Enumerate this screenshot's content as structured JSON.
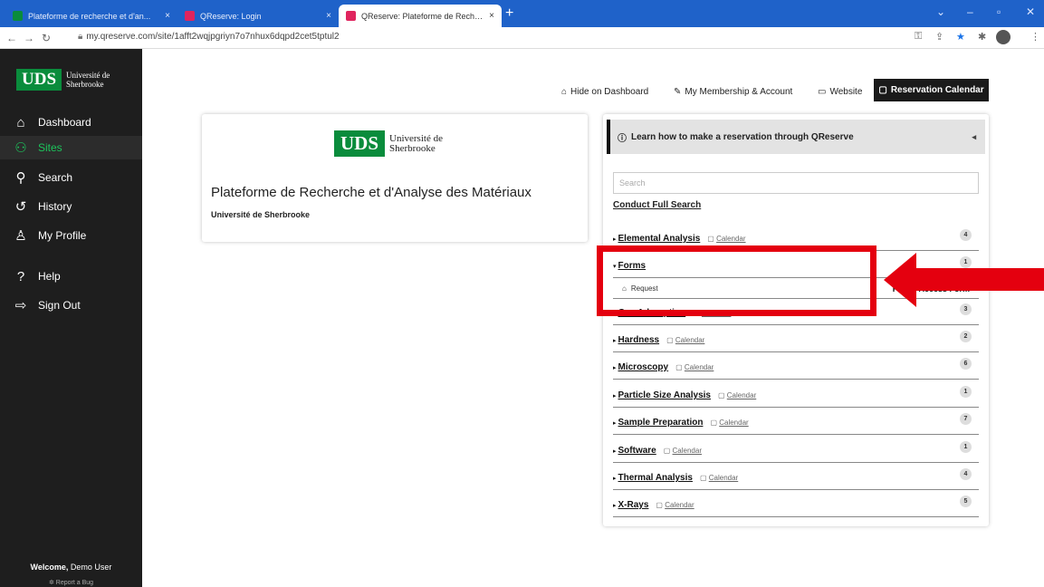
{
  "browser": {
    "tabs": [
      {
        "title": "Plateforme de recherche et d'an...",
        "close": "×"
      },
      {
        "title": "QReserve: Login",
        "close": "×"
      },
      {
        "title": "QReserve: Plateforme de Recherc...",
        "close": "×"
      }
    ],
    "new_tab": "+",
    "url": "my.qreserve.com/site/1afft2wqjpgriyn7o7nhux6dqpd2cet5tptul2"
  },
  "sidebar": {
    "logo_abbr": "UDS",
    "logo_text_line1": "Université de",
    "logo_text_line2": "Sherbrooke",
    "items": [
      {
        "label": "Dashboard",
        "icon": "home-icon"
      },
      {
        "label": "Sites",
        "icon": "sites-icon"
      },
      {
        "label": "Search",
        "icon": "search-icon"
      },
      {
        "label": "History",
        "icon": "history-icon"
      },
      {
        "label": "My Profile",
        "icon": "user-icon"
      },
      {
        "label": "Help",
        "icon": "help-icon"
      },
      {
        "label": "Sign Out",
        "icon": "sign-out-icon"
      }
    ],
    "welcome_bold": "Welcome,",
    "welcome_name": "Demo User",
    "report": "Report a Bug",
    "active_color": "#1cc45b"
  },
  "topnav": {
    "hide": "Hide on Dashboard",
    "membership": "My Membership & Account",
    "website": "Website",
    "calendar": "Reservation Calendar"
  },
  "site": {
    "logo_abbr": "UDS",
    "logo_line1": "Université de",
    "logo_line2": "Sherbrooke",
    "title": "Plateforme de Recherche et d'Analyse des Matériaux",
    "subtitle": "Université de Sherbrooke"
  },
  "panel": {
    "learn": "Learn how to make a reservation through QReserve",
    "search_placeholder": "Search",
    "full_search": "Conduct Full Search",
    "calendar_label": "Calendar",
    "categories": [
      {
        "name": "Elemental Analysis",
        "count": "4",
        "calendar": true,
        "expanded": false
      },
      {
        "name": "Forms",
        "count": "1",
        "calendar": false,
        "expanded": true
      },
      {
        "name": "Gas Adsorption",
        "count": "3",
        "calendar": true,
        "expanded": false
      },
      {
        "name": "Hardness",
        "count": "2",
        "calendar": true,
        "expanded": false
      },
      {
        "name": "Microscopy",
        "count": "6",
        "calendar": true,
        "expanded": false
      },
      {
        "name": "Particle Size Analysis",
        "count": "1",
        "calendar": true,
        "expanded": false
      },
      {
        "name": "Sample Preparation",
        "count": "7",
        "calendar": true,
        "expanded": false
      },
      {
        "name": "Software",
        "count": "1",
        "calendar": true,
        "expanded": false
      },
      {
        "name": "Thermal Analysis",
        "count": "4",
        "calendar": true,
        "expanded": false
      },
      {
        "name": "X-Rays",
        "count": "5",
        "calendar": true,
        "expanded": false
      }
    ],
    "form_row": {
      "action": "Request",
      "name": "PRAM Access Form"
    }
  },
  "colors": {
    "brand_green": "#0a8c3c",
    "annotation_red": "#e4000f",
    "tab_blue": "#1f62c9"
  }
}
